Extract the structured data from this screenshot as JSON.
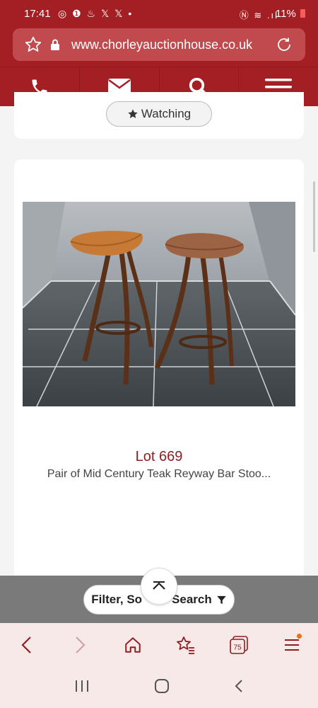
{
  "status_bar": {
    "time": "17:41",
    "battery": "11%",
    "left_icons": [
      "threads-icon",
      "alert-icon",
      "fire-icon",
      "x-icon",
      "x-icon",
      "dot"
    ],
    "right_icons": [
      "nfc-icon",
      "wifi-icon",
      "signal-icon",
      "battery-icon"
    ]
  },
  "browser": {
    "url": "www.chorleyauctionhouse.co.uk",
    "tab_count": "75"
  },
  "nav": {
    "items": [
      "phone-icon",
      "mail-icon",
      "search-icon",
      "menu-icon"
    ]
  },
  "watching": {
    "label": "Watching"
  },
  "lot": {
    "number": "Lot 669",
    "title": "Pair of Mid Century Teak Reyway Bar Stoo..."
  },
  "filter": {
    "label_left": "Filter, So",
    "label_right": "Search"
  },
  "colors": {
    "brand": "#a31f24",
    "lot_number": "#8f1e22",
    "toolbar_bg": "#f6e9e8",
    "toolbar_icon": "#8f1e22",
    "badge": "#e8711f"
  }
}
